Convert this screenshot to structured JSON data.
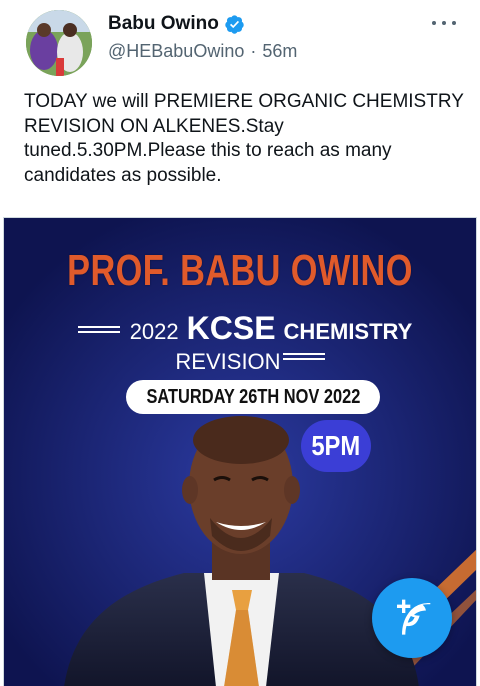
{
  "tweet": {
    "author_name": "Babu Owino",
    "handle": "@HEBabuOwino",
    "separator": "·",
    "time_ago": "56m",
    "text": "TODAY we will PREMIERE ORGANIC CHEMISTRY REVISION ON ALKENES.Stay tuned.5.30PM.Please this to reach as many candidates as possible."
  },
  "poster": {
    "title": "PROF. BABU OWINO",
    "year": "2022",
    "exam": "KCSE",
    "subject": "CHEMISTRY",
    "line2": "REVISION",
    "date": "SATURDAY 26TH NOV 2022",
    "time": "5PM"
  },
  "icons": {
    "verified": "verified-badge-icon",
    "more": "more-options-icon",
    "compose": "compose-tweet-icon"
  },
  "colors": {
    "accent": "#1d9bf0",
    "poster_bg": "#131c66",
    "poster_title": "#e05a2b",
    "time_badge": "#3b3ed6"
  }
}
